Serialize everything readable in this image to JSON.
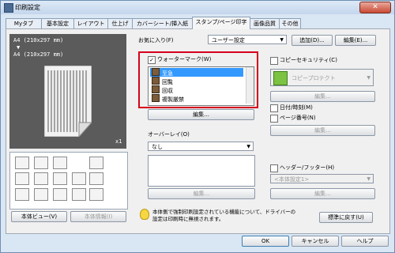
{
  "window": {
    "title": "印刷設定",
    "close_glyph": "✕"
  },
  "tabs": [
    "Myタブ",
    "基本設定",
    "レイアウト",
    "仕上げ",
    "カバーシート/挿入紙",
    "スタンプ/ページ印字",
    "画像品質",
    "その他"
  ],
  "preview": {
    "paper_line1": "A4 (210x297 mm)",
    "arrow": "▼",
    "paper_line2": "A4 (210x297 mm)",
    "copies": "x1"
  },
  "left_buttons": {
    "body_view": "本体ビュー(V)",
    "body_info": "本体情報(I)"
  },
  "favorites": {
    "label": "お気に入り(F)",
    "value": "ユーザー設定",
    "add_button": "追加(D)...",
    "edit_button": "編集(E)..."
  },
  "watermark": {
    "checkbox_label": "ウォーターマーク(W)",
    "checked": true,
    "items": [
      "至急",
      "回覧",
      "回収",
      "複製厳禁"
    ],
    "selected_index": 0,
    "edit_button": "編集..."
  },
  "overlay": {
    "label": "オーバーレイ(O)",
    "value": "なし",
    "edit_button": "編集..."
  },
  "copy_security": {
    "label": "コピーセキュリティ(C)",
    "value": "コピープロテクト",
    "edit_button": "編集..."
  },
  "date_time": {
    "label": "日付/時刻(M)",
    "edit_button": "編集..."
  },
  "page_number": {
    "label": "ページ番号(N)",
    "edit_button": "編集..."
  },
  "header_footer": {
    "label": "ヘッダー/フッター(H)",
    "value": "<本体設定1>",
    "edit_button": "編集..."
  },
  "note": {
    "text": "本体側で強制印刷設定されている機能について、ドライバーの設定は印刷時に無視されます。"
  },
  "restore_button": "標準に戻す(U)",
  "dialog_buttons": {
    "ok": "OK",
    "cancel": "キャンセル",
    "help": "ヘルプ"
  }
}
